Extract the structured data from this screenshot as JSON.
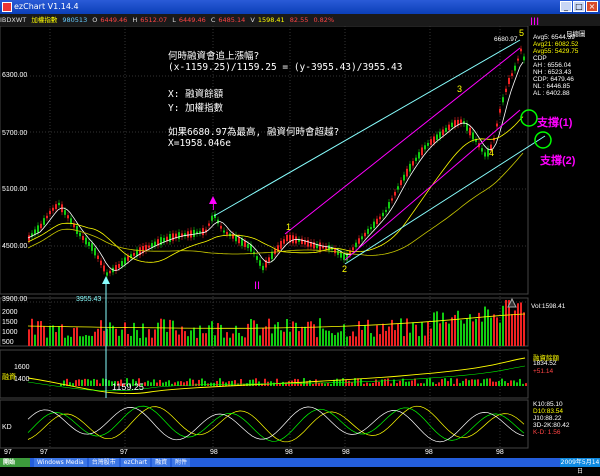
{
  "window": {
    "title": "ezChart V1.14.4",
    "buttons": [
      "_",
      "□",
      "×"
    ]
  },
  "infobar": {
    "symbol": "IBDXWT",
    "name": "加權指數",
    "date": "980513",
    "fields": [
      {
        "label": "O",
        "value": "6449.46"
      },
      {
        "label": "H",
        "value": "6512.07"
      },
      {
        "label": "L",
        "value": "6449.46"
      },
      {
        "label": "C",
        "value": "6485.14"
      },
      {
        "label": "V",
        "value": "1598.41"
      },
      {
        "label": "",
        "value": "82.55"
      },
      {
        "label": "",
        "value": "0.82%"
      }
    ]
  },
  "notes": {
    "question1": "何時融資會追上漲幅?",
    "formula": "(x-1159.25)/1159.25 = (y-3955.43)/3955.43",
    "x_def": "X:  融資餘額",
    "y_def": "Y:  加權指數",
    "question2": "如果6680.97為最高, 融資何時會超越?",
    "answer": "X=1958.046e"
  },
  "price_axis": [
    "6300.00",
    "5700.00",
    "5100.00",
    "4500.00",
    "3900.00"
  ],
  "volume_axis": [
    "2000",
    "1500",
    "1000",
    "500"
  ],
  "margin_axis": [
    "1600",
    "1400"
  ],
  "kd_axis": [
    "KD"
  ],
  "time_axis": [
    "97",
    "97",
    "97",
    "98",
    "98",
    "98",
    "98",
    "98"
  ],
  "labels": {
    "wave_I": "I",
    "wave_II": "II",
    "wave_III": "III",
    "wave_1": "1",
    "wave_2": "2",
    "wave_3": "3",
    "wave_4": "4",
    "wave_5": "5",
    "low_price": "3955.43",
    "low_margin": "1159.25",
    "high_price": "6680.97",
    "support1": "支撐(1)",
    "support2": "支撐(2)",
    "daily": "日總圖",
    "margin_panel": "融資",
    "margin_label": "融資餘額",
    "vol_readout": "Vol:1598.41"
  },
  "right_panel": [
    {
      "text": "Avg5: 6544.39",
      "color": "#ffffff"
    },
    {
      "text": "Avg21: 6082.52",
      "color": "#ffff00"
    },
    {
      "text": "Avg55: 5429.75",
      "color": "#ffff00"
    },
    {
      "text": "CDP",
      "color": "#ffffff"
    },
    {
      "text": "AH : 6556.04",
      "color": "#ffffff"
    },
    {
      "text": "NH : 6523.43",
      "color": "#ffffff"
    },
    {
      "text": "CDP: 6479.46",
      "color": "#ffffff"
    },
    {
      "text": "NL : 6446.85",
      "color": "#ffffff"
    },
    {
      "text": "AL : 6402.88",
      "color": "#ffffff"
    }
  ],
  "margin_readout": [
    "1834.52",
    "+51.14"
  ],
  "kd_readout": [
    "K10:85.10",
    "D10:83.54",
    "J10:88.22",
    "3D-2K:80.42",
    "K-D: 1.56"
  ],
  "taskbar": {
    "start": "開始",
    "tasks": [
      "Windows Media",
      "台灣股市",
      "ezChart",
      "融資",
      "附件"
    ],
    "clock": "2009年5月14日"
  },
  "colors": {
    "up": "#e22",
    "down": "#1c1",
    "avg5": "#ffffff",
    "avg21": "#ffff00",
    "avg55": "#c8c800",
    "channel_cyan": "#8ff",
    "channel_mag": "#f0f"
  }
}
